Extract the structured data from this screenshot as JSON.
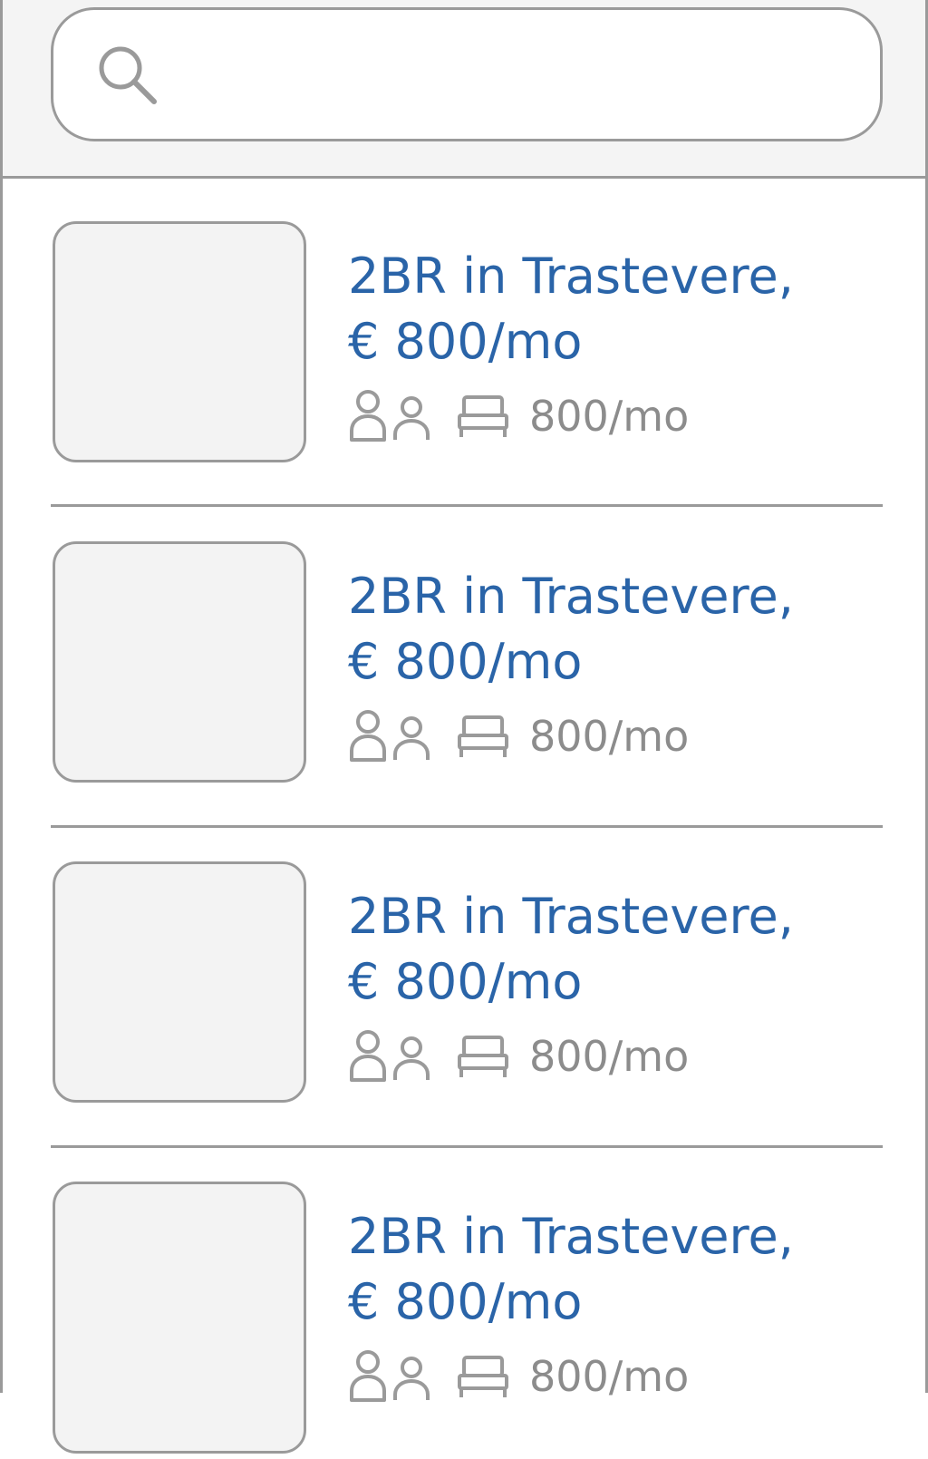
{
  "search": {
    "value": "",
    "placeholder": ""
  },
  "listings": [
    {
      "title_line1": "2BR in Trastevere,",
      "title_line2": "€ 800/mo",
      "meta_price": "800/mo"
    },
    {
      "title_line1": "2BR in Trastevere,",
      "title_line2": "€ 800/mo",
      "meta_price": "800/mo"
    },
    {
      "title_line1": "2BR in Trastevere,",
      "title_line2": "€ 800/mo",
      "meta_price": "800/mo"
    },
    {
      "title_line1": "2BR in Trastevere,",
      "title_line2": "€ 800/mo",
      "meta_price": "800/mo"
    }
  ],
  "icons": {
    "search": "search-icon",
    "people": "people-icon",
    "bed": "bed-icon"
  },
  "colors": {
    "title": "#2a64a8",
    "meta": "#8c8c8c",
    "border": "#9a9a9a",
    "header_bg": "#f4f4f4",
    "thumb_bg": "#f3f3f3"
  }
}
